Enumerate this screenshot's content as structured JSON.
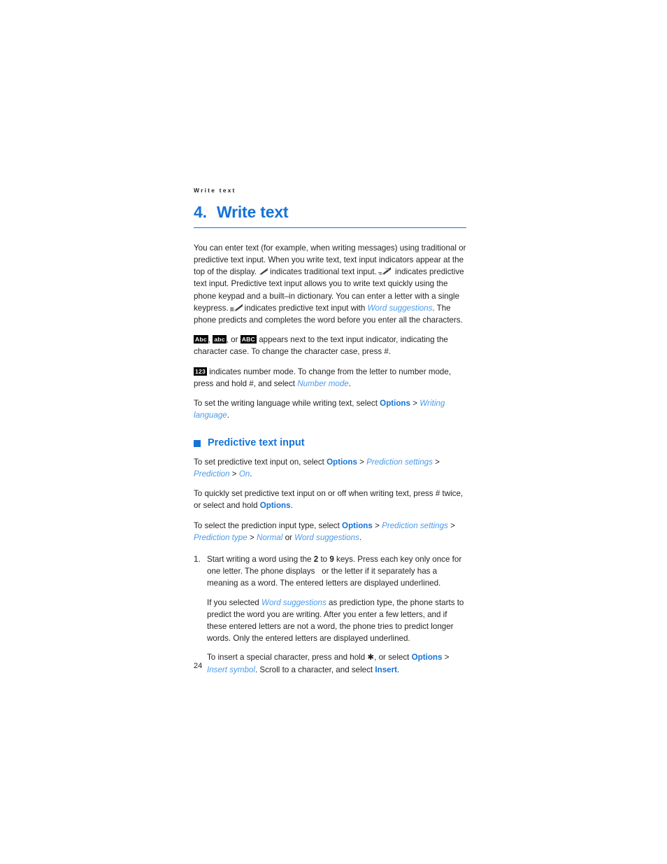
{
  "document": {
    "running_header": "Write text",
    "page_number": "24"
  },
  "chapter": {
    "number": "4.",
    "title": "Write text"
  },
  "intro": {
    "p1_a": "You can enter text (for example, when writing messages) using traditional or predictive text input. When you write text, text input indicators appear at the top of the display.",
    "p1_b": "indicates traditional text input.",
    "p1_c": "indicates predictive text input. Predictive text input allows you to write text quickly using the phone keypad and a built–in dictionary. You can enter a letter with a single keypress.",
    "p1_d": "indicates predictive text input with",
    "p1_link": "Word suggestions",
    "p1_e": ". The phone predicts and completes the word before you enter all the characters.",
    "p2_badge_abc_mixed": "Abc",
    "p2_badge_abc_lower": "abc",
    "p2_comma": ",",
    "p2_or": ", or",
    "p2_badge_abc_upper": "ABC",
    "p2_text": "appears next to the text input indicator, indicating the character case. To change the character case, press #.",
    "p3_badge_123": "123",
    "p3_a": "indicates number mode. To change from the letter to number mode, press and hold #, and select",
    "p3_link": "Number mode",
    "p3_end": ".",
    "p4_a": "To set the writing language while writing text, select",
    "p4_cmd": "Options",
    "p4_gt": ">",
    "p4_link": "Writing language",
    "p4_end": "."
  },
  "section": {
    "heading": "Predictive text input",
    "p1_a": "To set predictive text input on, select",
    "p1_cmd": "Options",
    "p1_gt1": ">",
    "p1_link1": "Prediction settings",
    "p1_gt2": ">",
    "p1_link2": "Prediction",
    "p1_gt3": ">",
    "p1_link3": "On",
    "p1_end": ".",
    "p2_a": "To quickly set predictive text input on or off when writing text, press # twice, or select and hold",
    "p2_cmd": "Options",
    "p2_end": ".",
    "p3_a": "To select the prediction input type, select",
    "p3_cmd": "Options",
    "p3_gt1": ">",
    "p3_link1": "Prediction settings",
    "p3_gt2": ">",
    "p3_link2": "Prediction type",
    "p3_gt3": ">",
    "p3_link3": "Normal",
    "p3_or": "or",
    "p3_link4": "Word suggestions",
    "p3_end": "."
  },
  "steps": [
    {
      "marker": "1.",
      "text_a": "Start writing a word using the",
      "key_from": "2",
      "text_to": "to",
      "key_to": "9",
      "text_b": "keys. Press each key only once for one letter. The phone displays",
      "text_c": "or the letter if it separately has a meaning as a word. The entered letters are displayed underlined."
    }
  ],
  "step_notes": {
    "note1_a": "If you selected",
    "note1_link": "Word suggestions",
    "note1_b": "as prediction type, the phone starts to predict the word you are writing. After you enter a few letters, and if these entered letters are not a word, the phone tries to predict longer words. Only the entered letters are displayed underlined.",
    "note2_a": "To insert a special character, press and hold ✱, or select",
    "note2_cmd": "Options",
    "note2_gt": ">",
    "note2_link": "Insert symbol",
    "note2_b": ". Scroll to a character, and select",
    "note2_cmd2": "Insert",
    "note2_end": "."
  },
  "colors": {
    "accent_blue": "#1573d6",
    "param_blue": "#4a9ae8",
    "body_text": "#231f20",
    "badge_bg": "#000000"
  },
  "icons": {
    "traditional_pen": "pen-icon",
    "predictive_pen": "pen-motion-icon",
    "predictive_word_pen": "pen-lines-icon",
    "section_bullet": "square-bullet-icon"
  }
}
